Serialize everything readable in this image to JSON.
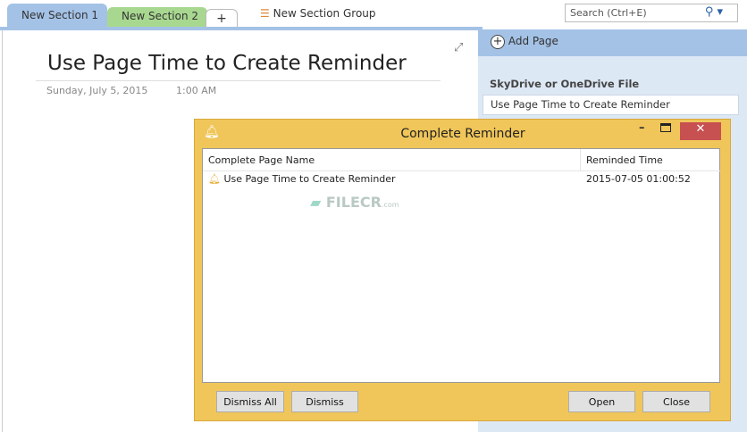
{
  "tabs": [
    "New Section 1",
    "New Section 2",
    "+"
  ],
  "section_group": "New Section Group",
  "search_placeholder": "Search (Ctrl+E)",
  "page": {
    "title": "Use Page Time to Create Reminder",
    "date": "Sunday, July 5, 2015",
    "time": "1:00 AM"
  },
  "panel": {
    "add_page": "Add Page",
    "notebook": "SkyDrive or OneDrive File",
    "pages": [
      "Use Page Time to Create Reminder"
    ]
  },
  "dialog": {
    "title": "Complete Reminder",
    "columns": [
      "Complete Page Name",
      "Reminded Time"
    ],
    "rows": [
      {
        "name": "Use Page Time to Create Reminder",
        "time": "2015-07-05 01:00:52"
      }
    ],
    "buttons": {
      "dismiss_all": "Dismiss All",
      "dismiss": "Dismiss",
      "open": "Open",
      "close": "Close"
    }
  },
  "watermark": {
    "text": "FILECR",
    "sub": ".com"
  }
}
